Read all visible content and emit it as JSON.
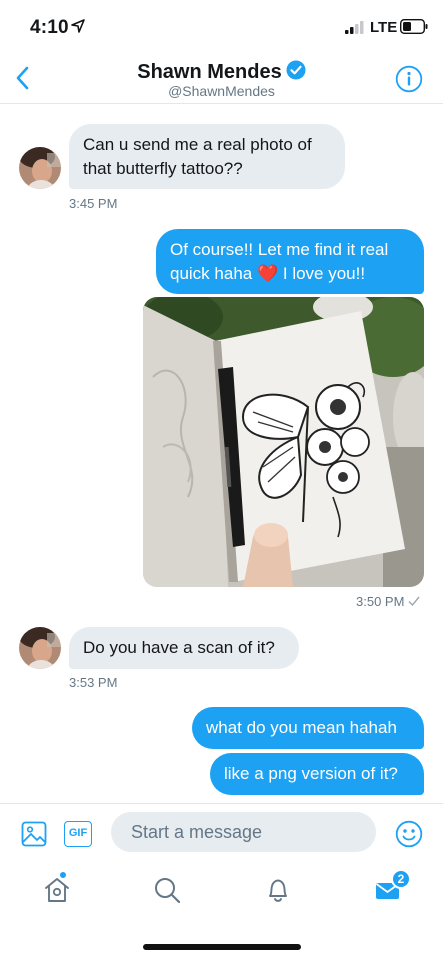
{
  "status": {
    "time": "4:10",
    "network": "LTE"
  },
  "header": {
    "name": "Shawn Mendes",
    "handle": "@ShawnMendes"
  },
  "messages": [
    {
      "dir": "in",
      "text_line1": "Can u send me a real photo of",
      "text_line2": "that butterfly tattoo??",
      "time": "3:45 PM"
    },
    {
      "dir": "out",
      "text_line1": "Of course!! Let me find it real",
      "text_line2a": "quick haha",
      "heart": "❤️",
      "text_line2b": "I love you!!"
    },
    {
      "dir": "out",
      "type": "photo",
      "time": "3:50 PM"
    },
    {
      "dir": "in",
      "text": "Do you have a scan of it?",
      "time": "3:53 PM"
    },
    {
      "dir": "out",
      "text": "what do you mean hahah"
    },
    {
      "dir": "out",
      "text": "like a png version of it?"
    }
  ],
  "composer": {
    "placeholder": "Start a message",
    "gif_label": "GIF"
  },
  "tabbar": {
    "messages_badge": "2"
  },
  "colors": {
    "accent": "#1da1f2",
    "incoming_bubble": "#e6ecf0",
    "secondary_text": "#657786",
    "heart": "#e0245e"
  }
}
